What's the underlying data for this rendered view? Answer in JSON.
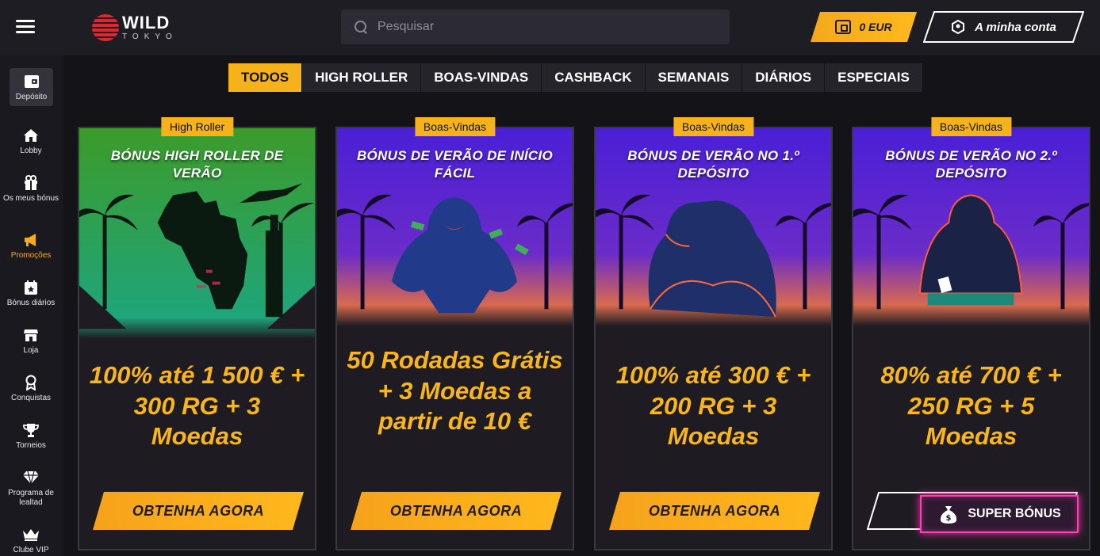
{
  "header": {
    "logo_main": "WILD",
    "logo_sub": "TOKYO",
    "search_placeholder": "Pesquisar",
    "wallet": "0 EUR",
    "account": "A minha conta"
  },
  "sidebar": {
    "items": [
      {
        "label": "Depósito",
        "icon": "wallet-icon"
      },
      {
        "label": "Lobby",
        "icon": "home-icon"
      },
      {
        "label": "Os meus bónus",
        "icon": "gift-icon"
      },
      {
        "label": "Promoções",
        "icon": "megaphone-icon"
      },
      {
        "label": "Bónus diários",
        "icon": "calendar-icon"
      },
      {
        "label": "Loja",
        "icon": "shop-icon"
      },
      {
        "label": "Conquistas",
        "icon": "medal-icon"
      },
      {
        "label": "Torneios",
        "icon": "trophy-icon"
      },
      {
        "label": "Programa de lealtad",
        "icon": "diamond-icon"
      },
      {
        "label": "Clube VIP",
        "icon": "crown-icon"
      }
    ]
  },
  "tabs": [
    "TODOS",
    "HIGH ROLLER",
    "BOAS-VINDAS",
    "CASHBACK",
    "SEMANAIS",
    "DIÁRIOS",
    "ESPECIAIS"
  ],
  "cards": [
    {
      "badge": "High Roller",
      "title": "BÓNUS HIGH ROLLER DE VERÃO",
      "offer": "100% até 1 500 € + 300 RG + 3 Moedas",
      "cta": "OBTENHA AGORA"
    },
    {
      "badge": "Boas-Vindas",
      "title": "BÓNUS DE VERÃO DE INÍCIO FÁCIL",
      "offer": "50 Rodadas Grátis + 3 Moedas a partir de 10 €",
      "cta": "OBTENHA AGORA"
    },
    {
      "badge": "Boas-Vindas",
      "title": "BÓNUS DE VERÃO NO 1.º DEPÓSITO",
      "offer": "100% até 300 € + 200 RG + 3 Moedas",
      "cta": "OBTENHA AGORA"
    },
    {
      "badge": "Boas-Vindas",
      "title": "BÓNUS DE VERÃO NO 2.º DEPÓSITO",
      "offer": "80% até 700 € + 250 RG + 5 Moedas",
      "cta": ""
    }
  ],
  "super_bonus": "SUPER BÓNUS",
  "colors": {
    "accent": "#f6b21b",
    "background": "#141318",
    "neon": "#ff3fb5"
  }
}
